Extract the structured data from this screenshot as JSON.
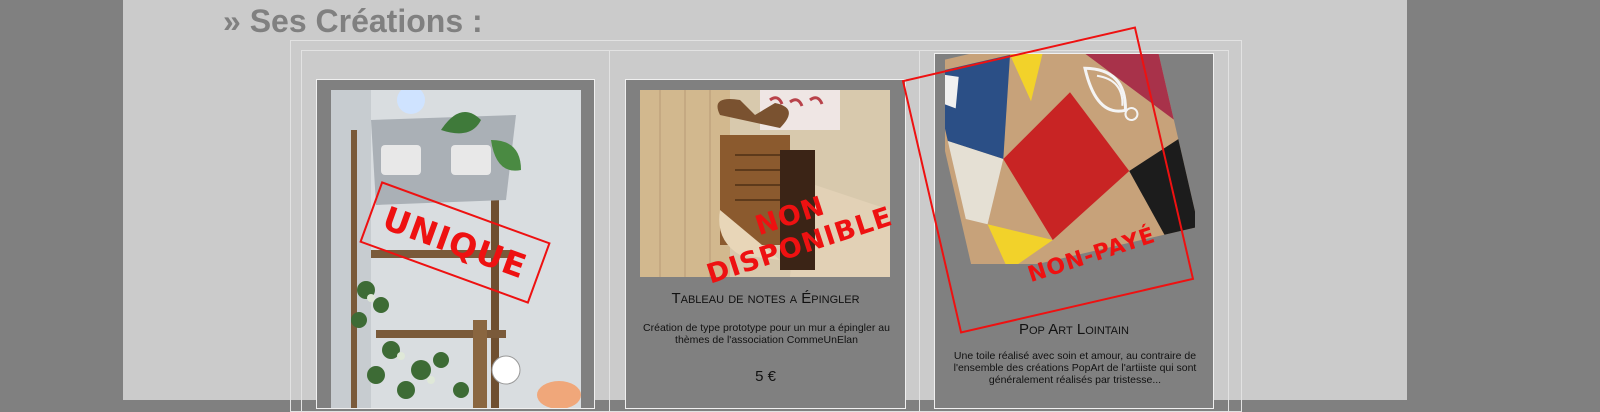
{
  "section": {
    "title": "» Ses Créations :"
  },
  "cards": [
    {
      "title": "",
      "description": "",
      "price": "",
      "stamp": "UNIQUE",
      "photo": "plant-shelf-photo"
    },
    {
      "title": "Tableau de notes a Épingler",
      "description": "Création de type prototype pour un mur a épingler au thèmes de l'association CommeUnElan",
      "price": "5 €",
      "stamp_line1": "NON",
      "stamp_line2": "DISPONIBLE",
      "photo": "moose-pinboard-photo"
    },
    {
      "title": "Pop Art Lointain",
      "description": "Une toile réalisé avec soin et amour, au contraire de l'ensemble des créations PopArt de l'artiiste qui sont généralement réalisés par tristesse...",
      "price": "",
      "stamp": "NON-PAYÉ",
      "photo": "pop-art-canvas-photo"
    }
  ],
  "colors": {
    "page_background": "#808080",
    "content_background": "#cbcbcb",
    "card_background": "#808080",
    "stamp_red": "#ee1111",
    "title_grey": "#808080"
  }
}
